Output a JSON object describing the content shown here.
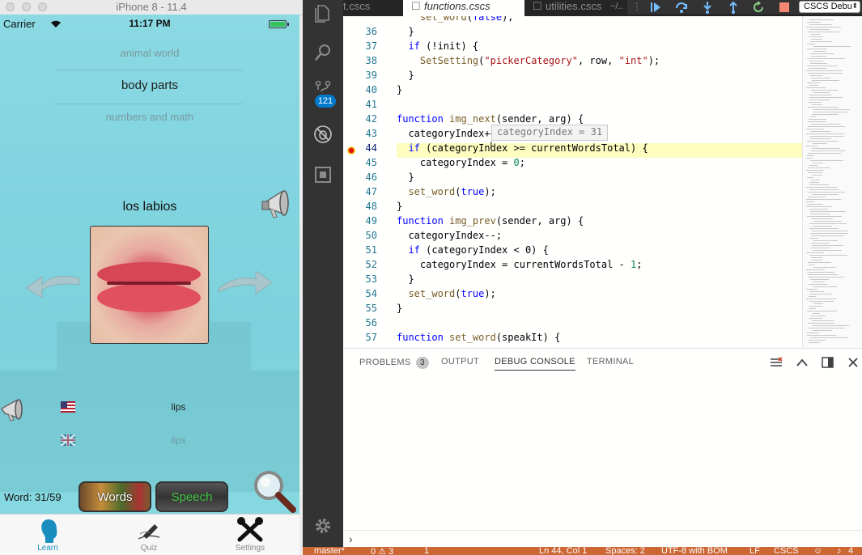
{
  "simulator": {
    "window_title": "iPhone 8 - 11.4",
    "status": {
      "carrier": "Carrier",
      "time": "11:17 PM"
    },
    "picker": {
      "above": "animal world",
      "selected": "body parts",
      "below": "numbers and math"
    },
    "word_spanish": "los labios",
    "translations": [
      {
        "text": "lips",
        "flag": "us-flag-icon"
      },
      {
        "text": "lips",
        "flag": "uk-flag-icon"
      }
    ],
    "word_count": "Word: 31/59",
    "buttons": {
      "words": "Words",
      "speech": "Speech"
    },
    "tabs": [
      {
        "label": "Learn",
        "active": true
      },
      {
        "label": "Quiz",
        "active": false
      },
      {
        "label": "Settings",
        "active": false
      }
    ],
    "colors": {
      "background": "#80d4df",
      "tab_active": "#1a8fbf"
    }
  },
  "vscode": {
    "editor_tabs": [
      {
        "label": "t.cscs",
        "active": false
      },
      {
        "label": "functions.cscs",
        "active": true
      },
      {
        "label": "utilities.cscs",
        "active": false
      },
      {
        "label": "~/..",
        "active": false
      }
    ],
    "debug_config": "CSCS Debu",
    "source_control_badge": "121",
    "lines": [
      {
        "n": "",
        "t": "    set_word(false);"
      },
      {
        "n": "36",
        "t": "  }"
      },
      {
        "n": "37",
        "t": "  if (!init) {"
      },
      {
        "n": "38",
        "t": "    SetSetting(\"pickerCategory\", row, \"int\");"
      },
      {
        "n": "39",
        "t": "  }"
      },
      {
        "n": "40",
        "t": "}"
      },
      {
        "n": "41",
        "t": ""
      },
      {
        "n": "42",
        "t": "function img_next(sender, arg) {"
      },
      {
        "n": "43",
        "t": "  categoryIndex++;"
      },
      {
        "n": "44",
        "t": "  if (categoryIndex >= currentWordsTotal) {"
      },
      {
        "n": "45",
        "t": "    categoryIndex = 0;"
      },
      {
        "n": "46",
        "t": "  }"
      },
      {
        "n": "47",
        "t": "  set_word(true);"
      },
      {
        "n": "48",
        "t": "}"
      },
      {
        "n": "49",
        "t": "function img_prev(sender, arg) {"
      },
      {
        "n": "50",
        "t": "  categoryIndex--;"
      },
      {
        "n": "51",
        "t": "  if (categoryIndex < 0) {"
      },
      {
        "n": "52",
        "t": "    categoryIndex = currentWordsTotal - 1;"
      },
      {
        "n": "53",
        "t": "  }"
      },
      {
        "n": "54",
        "t": "  set_word(true);"
      },
      {
        "n": "55",
        "t": "}"
      },
      {
        "n": "56",
        "t": ""
      },
      {
        "n": "57",
        "t": "function set_word(speakIt) {"
      }
    ],
    "breakpoint_line": "44",
    "hover_tooltip": "categoryIndex = 31",
    "panel_tabs": [
      {
        "label": "PROBLEMS",
        "badge": "3",
        "active": false
      },
      {
        "label": "OUTPUT",
        "active": false
      },
      {
        "label": "DEBUG CONSOLE",
        "active": true
      },
      {
        "label": "TERMINAL",
        "active": false
      }
    ],
    "console_prompt": "›",
    "statusbar": {
      "branch": "master*",
      "problems": "0 ⚠ 3",
      "debug": "1",
      "position": "Ln 44, Col 1",
      "spaces": "Spaces: 2",
      "encoding": "UTF-8 with BOM",
      "eol": "LF",
      "language": "CSCS",
      "notifications": "4"
    },
    "colors": {
      "statusbar": "#cc6633",
      "line_highlight": "#fdfdc0",
      "keyword": "#0000ff",
      "string": "#a31515"
    }
  }
}
